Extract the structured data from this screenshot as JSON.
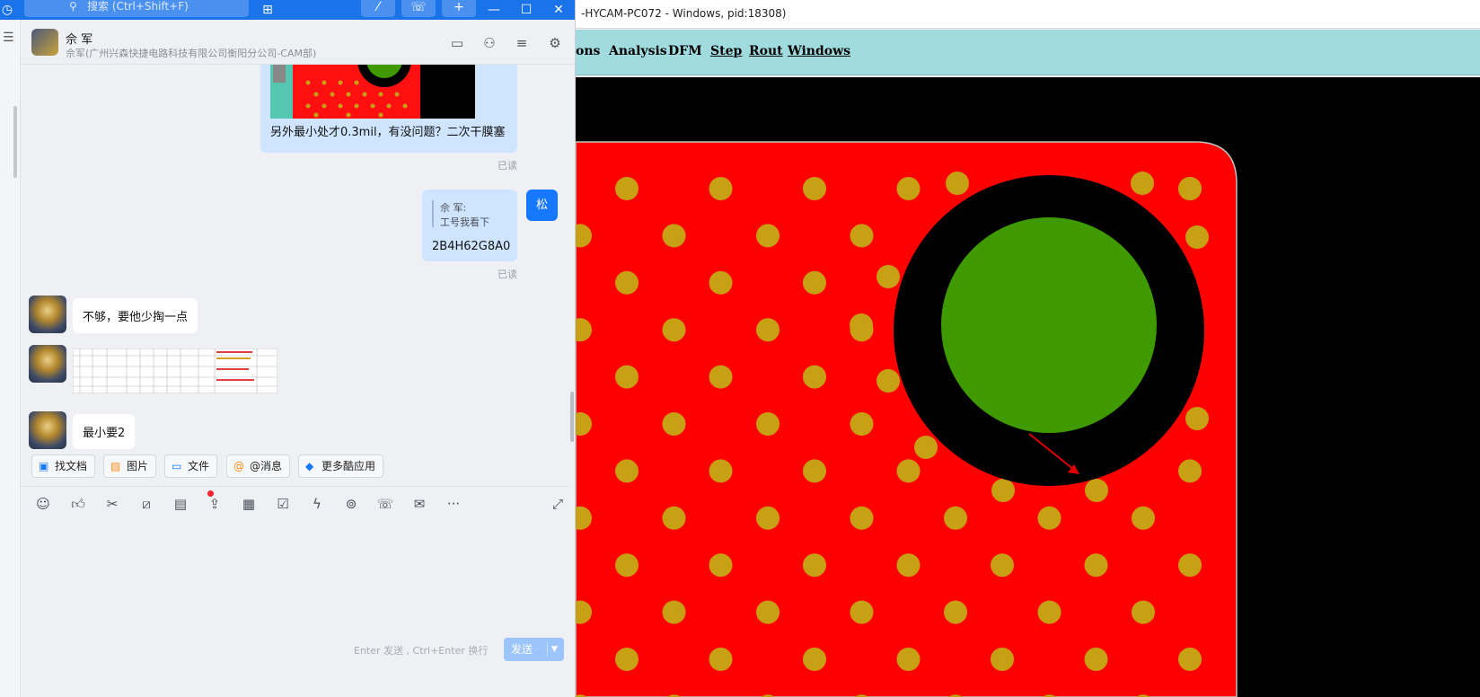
{
  "chat": {
    "search_placeholder": "搜索 (Ctrl+Shift+F)",
    "contact_name": "佘 军",
    "contact_subtitle": "佘军(广州兴森快捷电路科技有限公司衡阳分公司-CAM部)",
    "messages": {
      "msg1_text": "另外最小处才0.3mil，有没问题？二次干膜塞",
      "read_label": "已读",
      "quote_author": "佘 军:",
      "quote_text": "工号我看下",
      "msg2_text": "2B4H62G8A0",
      "my_avatar_char": "松",
      "msg3_text": "不够，要他少掏一点",
      "msg5_text": "最小要2"
    },
    "quick_actions": [
      "找文档",
      "图片",
      "文件",
      "@消息",
      "更多酷应用"
    ],
    "send_hint": "Enter 发送 , Ctrl+Enter 换行",
    "send_label": "发送"
  },
  "cam": {
    "window_title": "-HYCAM-PC072 - Windows, pid:18308)",
    "menu": [
      "ons",
      "Analysis",
      "DFM",
      "Step",
      "Rout",
      "Windows"
    ]
  },
  "colors": {
    "accent": "#1a73e8",
    "cam_menubar": "#9fdbdf",
    "board_red": "#ff0000",
    "pad_gold": "#c8a014",
    "pad_green": "#3f9a00"
  }
}
